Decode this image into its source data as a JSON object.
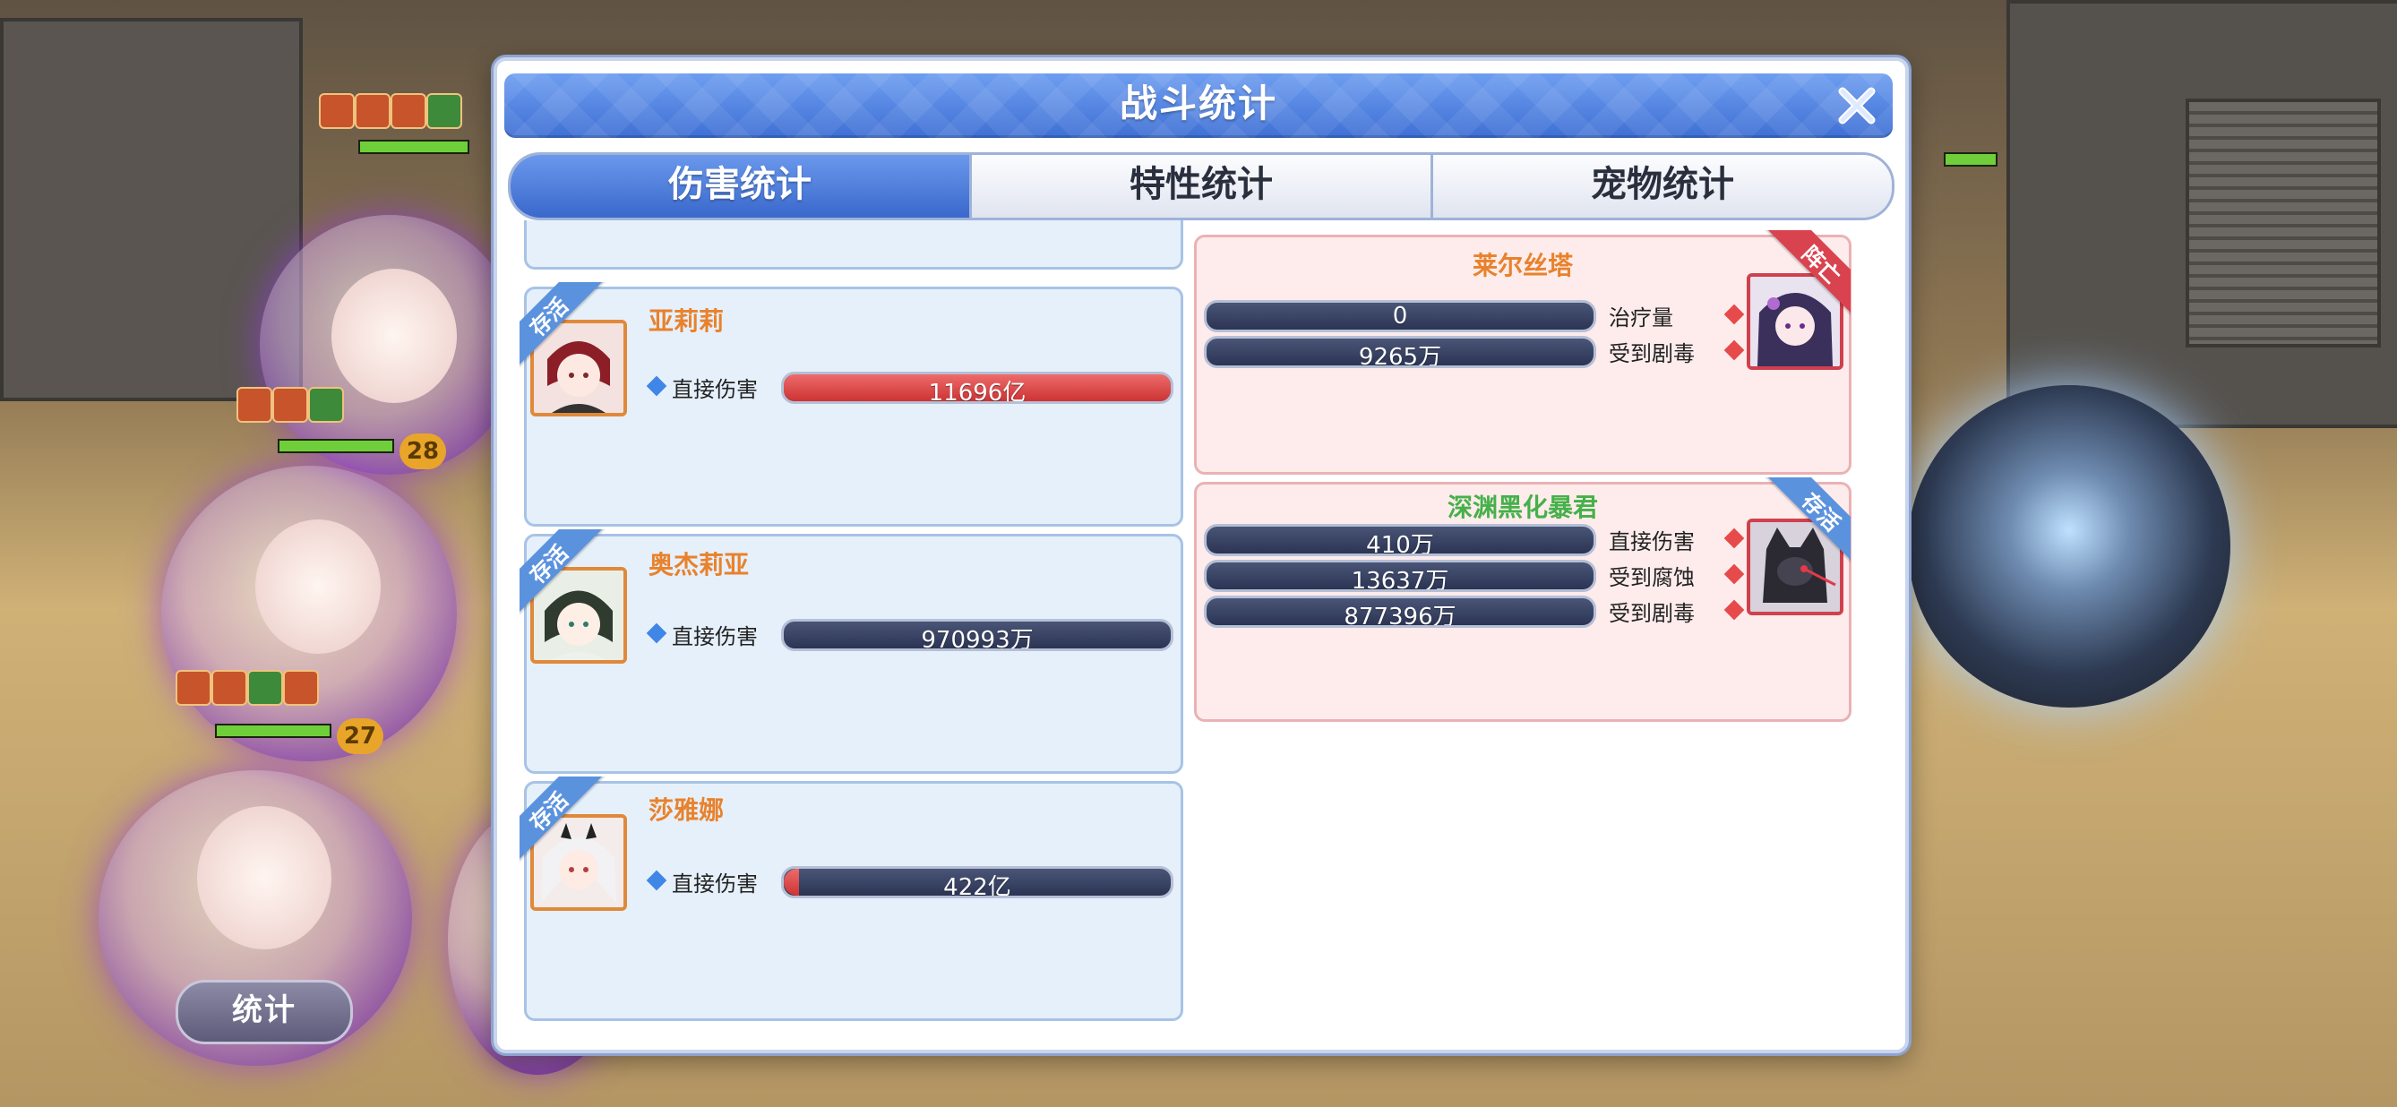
{
  "modal": {
    "title": "战斗统计",
    "tabs": [
      {
        "label": "伤害统计",
        "active": true
      },
      {
        "label": "特性统计",
        "active": false
      },
      {
        "label": "宠物统计",
        "active": false
      }
    ]
  },
  "allies": [
    {
      "name": "亚莉莉",
      "status": "存活",
      "stat_label": "直接伤害",
      "value": "11696亿",
      "fill": 1.0
    },
    {
      "name": "奥杰莉亚",
      "status": "存活",
      "stat_label": "直接伤害",
      "value": "970993万",
      "fill": 0.0
    },
    {
      "name": "莎雅娜",
      "status": "存活",
      "stat_label": "直接伤害",
      "value": "422亿",
      "fill": 0.04
    }
  ],
  "enemies": [
    {
      "name": "莱尔丝塔",
      "status": "阵亡",
      "stats": [
        {
          "label": "治疗量",
          "value": "0"
        },
        {
          "label": "受到剧毒",
          "value": "9265万"
        }
      ]
    },
    {
      "name": "深渊黑化暴君",
      "status": "存活",
      "stats": [
        {
          "label": "直接伤害",
          "value": "410万"
        },
        {
          "label": "受到腐蚀",
          "value": "13637万"
        },
        {
          "label": "受到剧毒",
          "value": "877396万"
        }
      ]
    }
  ],
  "hud": {
    "stats_button": "统计",
    "levels": [
      "28",
      "27"
    ]
  },
  "colors": {
    "accent_blue": "#3e6fd4",
    "alive_ribbon": "#5b92de",
    "dead_ribbon": "#d9434f",
    "ally_name": "#e8822c",
    "boss_name": "#46b04a"
  }
}
